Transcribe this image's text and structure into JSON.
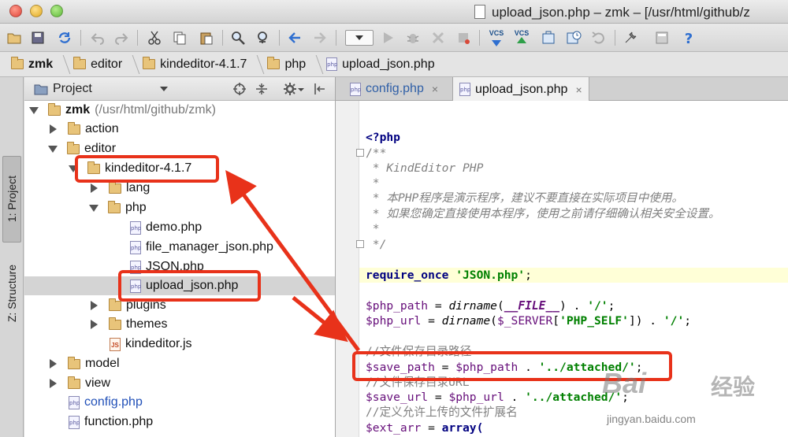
{
  "window": {
    "title": "upload_json.php – zmk – [/usr/html/github/z"
  },
  "breadcrumb": [
    {
      "label": "zmk",
      "icon": "folder-icon"
    },
    {
      "label": "editor",
      "icon": "folder-icon"
    },
    {
      "label": "kindeditor-4.1.7",
      "icon": "folder-icon"
    },
    {
      "label": "php",
      "icon": "folder-icon"
    },
    {
      "label": "upload_json.php",
      "icon": "php-file-icon"
    }
  ],
  "toolbar": {
    "vcs_label": "VCS",
    "icons": [
      "open-icon",
      "save-icon",
      "sync-icon",
      "undo-icon",
      "redo-icon",
      "cut-icon",
      "copy-icon",
      "paste-icon",
      "find-icon",
      "replace-icon",
      "back-icon",
      "forward-icon",
      "run-config-dropdown",
      "run-icon",
      "debug-icon",
      "coverage-icon",
      "stop-icon",
      "vcs-update-icon",
      "vcs-commit-icon",
      "compare-icon",
      "history-icon",
      "revert-icon",
      "settings-icon",
      "structure-icon",
      "help-icon"
    ]
  },
  "toolstrip": {
    "project_tab": "1: Project",
    "structure_tab": "Z: Structure"
  },
  "project_panel": {
    "title": "Project",
    "php_badge": "php",
    "js_badge": "JS",
    "tree": [
      {
        "label": "zmk",
        "suffix": "(/usr/html/github/zmk)",
        "type": "folder",
        "state": "open",
        "depth": 0,
        "bold": true
      },
      {
        "label": "action",
        "type": "folder",
        "state": "closed",
        "depth": 1
      },
      {
        "label": "editor",
        "type": "folder",
        "state": "open",
        "depth": 1
      },
      {
        "label": "kindeditor-4.1.7",
        "type": "folder",
        "state": "open",
        "depth": 2
      },
      {
        "label": "lang",
        "type": "folder",
        "state": "closed",
        "depth": 3
      },
      {
        "label": "php",
        "type": "folder",
        "state": "open",
        "depth": 3
      },
      {
        "label": "demo.php",
        "type": "php",
        "depth": 4
      },
      {
        "label": "file_manager_json.php",
        "type": "php",
        "depth": 4
      },
      {
        "label": "JSON.php",
        "type": "php",
        "depth": 4
      },
      {
        "label": "upload_json.php",
        "type": "php",
        "depth": 4,
        "selected": true
      },
      {
        "label": "plugins",
        "type": "folder",
        "state": "closed",
        "depth": 3
      },
      {
        "label": "themes",
        "type": "folder",
        "state": "closed",
        "depth": 3
      },
      {
        "label": "kindeditor.js",
        "type": "js",
        "depth": 3
      },
      {
        "label": "model",
        "type": "folder",
        "state": "closed",
        "depth": 1
      },
      {
        "label": "view",
        "type": "folder",
        "state": "closed",
        "depth": 1
      },
      {
        "label": "config.php",
        "type": "php",
        "depth": 1,
        "link": true
      },
      {
        "label": "function.php",
        "type": "php",
        "depth": 1
      }
    ]
  },
  "editor": {
    "tabs": [
      {
        "label": "config.php",
        "close": "×"
      },
      {
        "label": "upload_json.php",
        "close": "×"
      }
    ],
    "code": {
      "open_tag": "<?php",
      "doc_open": "/**",
      "doc_title": " * KindEditor PHP",
      "doc_blank": " *",
      "doc_line1": " * 本PHP程序是演示程序，建议不要直接在实际项目中使用。",
      "doc_line2": " * 如果您确定直接使用本程序，使用之前请仔细确认相关安全设置。",
      "doc_close": " */",
      "require_kw": "require_once",
      "require_arg": "'JSON.php'",
      "php_path_var": "$php_path",
      "php_path_fn": "dirname",
      "php_path_const": "__FILE__",
      "php_path_tail": "'/'",
      "php_url_var": "$php_url",
      "php_url_fn": "dirname",
      "php_url_server": "$_SERVER",
      "php_url_key": "'PHP_SELF'",
      "php_url_tail": "'/'",
      "comment_save_path": "//文件保存目录路径",
      "save_path_var": "$save_path",
      "save_path_ref": "$php_path",
      "save_path_str": "'../attached/'",
      "comment_save_url": "//文件保存目录URL",
      "save_url_var": "$save_url",
      "save_url_ref": "$php_url",
      "save_url_str": "'../attached/'",
      "comment_ext": "//定义允许上传的文件扩展名",
      "ext_var": "$ext_arr",
      "ext_fn": "array("
    }
  },
  "watermark": {
    "brand": "Bai",
    "brand_cn": "经验",
    "url": "jingyan.baidu.com"
  },
  "colors": {
    "callout": "#e8321a",
    "selection": "#d4d4d4",
    "current_line": "#ffffd7",
    "keyword": "#000080",
    "string": "#008000"
  }
}
